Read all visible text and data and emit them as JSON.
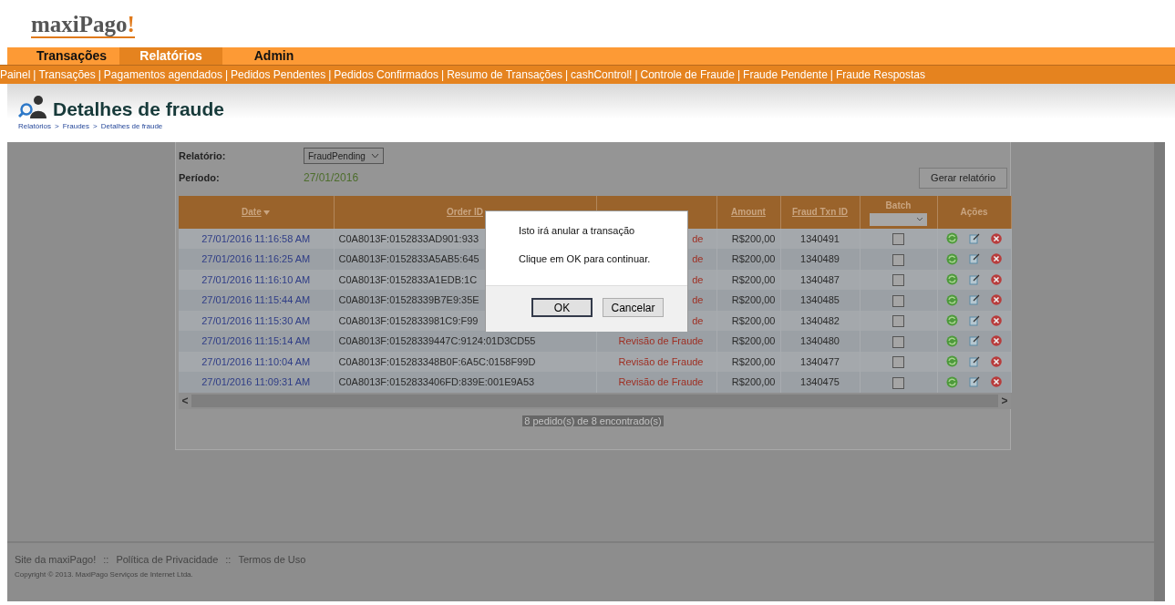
{
  "logo": {
    "text": "maxiPago",
    "mark": "!"
  },
  "tabs": [
    {
      "label": "Transações",
      "selected": false
    },
    {
      "label": "Relatórios",
      "selected": true
    },
    {
      "label": "Admin",
      "selected": false
    }
  ],
  "submenu": {
    "separator": "|",
    "items": [
      "Painel",
      "Transações",
      "Pagamentos agendados",
      "Pedidos Pendentes",
      "Pedidos Confirmados",
      "Resumo de Transações",
      "cashControl!",
      "Controle de Fraude",
      "Fraude Pendente",
      "Fraude Respostas"
    ]
  },
  "page_title": "Detalhes de fraude",
  "breadcrumb": {
    "separator": ">",
    "items": [
      "Relatórios",
      "Fraudes",
      "Detalhes de fraude"
    ]
  },
  "filters": {
    "report_label": "Relatório:",
    "report_value": "FraudPending",
    "period_label": "Período:",
    "period_value": "27/01/2016",
    "generate_button": "Gerar relatório"
  },
  "table": {
    "columns": [
      {
        "label": "Date",
        "kind": "sorted"
      },
      {
        "label": "Order ID",
        "kind": "sortable"
      },
      {
        "kind": "covered"
      },
      {
        "label": "Amount",
        "kind": "sortable"
      },
      {
        "label": "Fraud Txn ID",
        "kind": "sortable"
      },
      {
        "label": "Batch",
        "kind": "dropdown"
      },
      {
        "label": "Ações",
        "kind": "plain"
      }
    ],
    "rows": [
      {
        "date": "27/01/2016 11:16:58 AM",
        "order_id": "C0A8013F:0152833AD901:933",
        "status": "de",
        "amount": "R$200,00",
        "fraud_txn_id": "1340491",
        "batch_checked": false
      },
      {
        "date": "27/01/2016 11:16:25 AM",
        "order_id": "C0A8013F:0152833A5AB5:645",
        "status": "de",
        "amount": "R$200,00",
        "fraud_txn_id": "1340489",
        "batch_checked": false
      },
      {
        "date": "27/01/2016 11:16:10 AM",
        "order_id": "C0A8013F:0152833A1EDB:1C",
        "status": "de",
        "amount": "R$200,00",
        "fraud_txn_id": "1340487",
        "batch_checked": false
      },
      {
        "date": "27/01/2016 11:15:44 AM",
        "order_id": "C0A8013F:01528339B7E9:35E",
        "status": "de",
        "amount": "R$200,00",
        "fraud_txn_id": "1340485",
        "batch_checked": false
      },
      {
        "date": "27/01/2016 11:15:30 AM",
        "order_id": "C0A8013F:0152833981C9:F99",
        "status": "de",
        "amount": "R$200,00",
        "fraud_txn_id": "1340482",
        "batch_checked": false
      },
      {
        "date": "27/01/2016 11:15:14 AM",
        "order_id": "C0A8013F:01528339447C:9124:01D3CD55",
        "status": "Revisão de Fraude",
        "amount": "R$200,00",
        "fraud_txn_id": "1340480",
        "batch_checked": false
      },
      {
        "date": "27/01/2016 11:10:04 AM",
        "order_id": "C0A8013F:015283348B0F:6A5C:0158F99D",
        "status": "Revisão de Fraude",
        "amount": "R$200,00",
        "fraud_txn_id": "1340477",
        "batch_checked": false
      },
      {
        "date": "27/01/2016 11:09:31 AM",
        "order_id": "C0A8013F:0152833406FD:839E:001E9A53",
        "status": "Revisão de Fraude",
        "amount": "R$200,00",
        "fraud_txn_id": "1340475",
        "batch_checked": false
      }
    ],
    "scroll_left": "<",
    "scroll_right": ">",
    "summary": "8 pedido(s) de 8 encontrado(s)"
  },
  "dialog": {
    "lines": [
      "Isto irá anular a transação",
      "Clique em OK para continuar."
    ],
    "buttons": [
      {
        "label": "OK",
        "focused": true
      },
      {
        "label": "Cancelar",
        "focused": false
      }
    ]
  },
  "footer": {
    "separator": "::",
    "links": [
      "Site da maxiPago!",
      "Política de Privacidade",
      "Termos de Uso"
    ],
    "copyright": "Copyright © 2013. MaxiPago Serviços de Internet Ltda."
  }
}
